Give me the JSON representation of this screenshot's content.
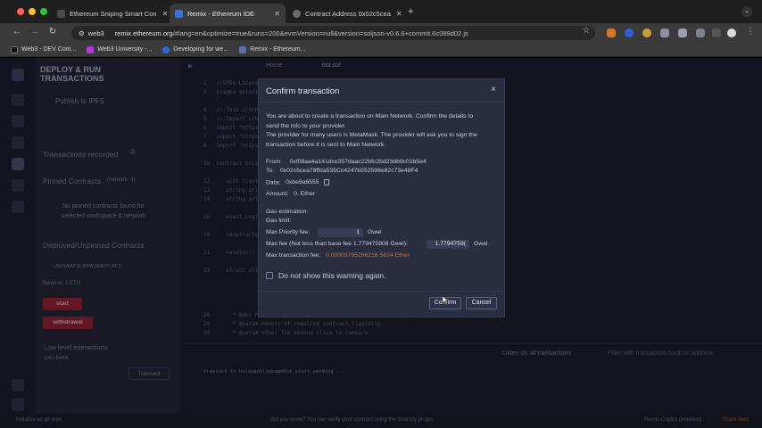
{
  "browser": {
    "tabs": [
      {
        "label": "Ethereum Sniping Smart Con",
        "active": false,
        "icon_color": "#4a4a4a"
      },
      {
        "label": "Remix - Ethereum IDE",
        "active": true,
        "icon_color": "#3b6fd9"
      },
      {
        "label": "Contract Address 0x02c5cea",
        "active": false,
        "icon_color": "#6b6b6b"
      }
    ],
    "address": {
      "site_chip": "web3",
      "url_main": "remix.ethereum.org",
      "url_rest": "/#lang=en&optimize=true&runs=200&evmVersion=null&version=soljson-v0.6.6+commit.6c089d02.js"
    },
    "bookmarks": [
      {
        "label": "Web3 - DEV Com...",
        "icon_color": "#111111"
      },
      {
        "label": "Web3 University -...",
        "icon_color": "#b03ad6"
      },
      {
        "label": "Developing for we...",
        "icon_color": "#2b6bd6"
      },
      {
        "label": "Remix - Ethereum...",
        "icon_color": "#5a6fb0"
      }
    ]
  },
  "remix": {
    "panel_title_line1": "DEPLOY & RUN",
    "panel_title_line2": "TRANSACTIONS",
    "publish_ipfs": "Publish to IPFS",
    "transactions_recorded": "Transactions recorded",
    "transactions_count": "2",
    "pinned_contracts": "Pinned Contracts",
    "pinned_network": "(network: 1)",
    "no_pinned_line1": "No pinned contracts found for",
    "no_pinned_line2": "selected workspace & network",
    "deployed_contracts": "Deployed/Unpinned Contracts",
    "contract_instance": "UNISWAPSLIPPAGEBOT AT 0",
    "balance": "Balance: 1 ETH",
    "start_button": "start",
    "withdrawal_button": "withdrawal",
    "low_level": "Low level interactions",
    "calldata": "CALLDATA",
    "transact": "Transact",
    "editor_tabs": [
      "Home",
      "bot.sol"
    ],
    "terminal_line": "transact to UniswapSlippageBot.start pending ...",
    "terminal_listen": "Listen on all transactions",
    "terminal_filter": "Filter with transaction hash or address",
    "status_left": "Initialize as git repo",
    "status_tip": "Did you know?  You can verify your contract using the Sourcify plugin.",
    "status_copilot": "Remix Copilot (enabled)",
    "status_scam": "Scam Alert"
  },
  "modal": {
    "title": "Confirm transaction",
    "close": "×",
    "description_lines": [
      "You are about to create a transaction on Main Network. Confirm the details to",
      "send the info to your provider.",
      "The provider for many users is MetaMask. The provider will ask you to sign the",
      "transaction before it is sent to Main Network."
    ],
    "from_label": "From:",
    "from_value": "0xf08aa4a141dce357daac22bfc2bd23db9c01b5e4",
    "to_label": "To:",
    "to_value": "0x02c5cea78ffda535Cc4247b552598e82c73e48F4",
    "data_label": "Data:",
    "data_value": "0xbe9a6555",
    "amount_label": "Amount:",
    "amount_value": "0. Ether",
    "gas_estimation": "Gas estimation:",
    "gas_limit": "Gas limit:",
    "priority_label": "Max Priority fee:",
    "priority_value": "1",
    "priority_unit": "Gwei",
    "maxfee_label": "Max fee (Not less than base fee 1.779475908 Gwei):",
    "maxfee_value": "1.7794759(",
    "maxfee_unit": "Gwei",
    "max_tx_fee_label": "Max transaction fee:",
    "max_tx_fee_value": "0.00003795266216 5824 Ether",
    "dont_show": "Do not show this warning again.",
    "confirm": "Confirm",
    "cancel": "Cancel"
  },
  "colors": {
    "accent_orange": "#d4772c",
    "danger_red": "#b0273d",
    "modal_bg": "#2a2c3f"
  }
}
